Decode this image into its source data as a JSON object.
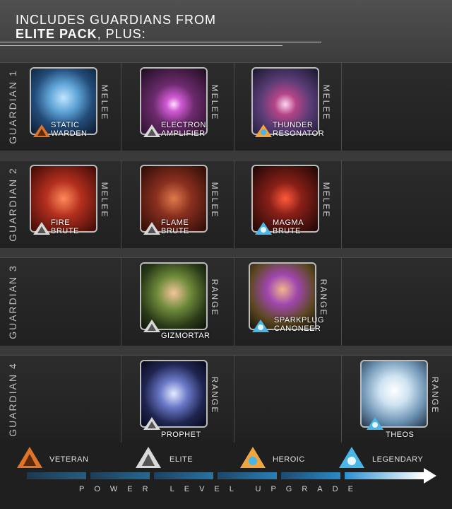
{
  "header": {
    "line1": "INCLUDES GUARDIANS FROM",
    "line2_bold": "ELITE PACK",
    "line2_rest": ", PLUS:"
  },
  "rows": [
    {
      "label": "GUARDIAN 1",
      "cards": [
        {
          "name1": "STATIC",
          "name2": "WARDEN",
          "tag": "MELEE",
          "rank": "veteran"
        },
        {
          "name1": "ELECTRON",
          "name2": "AMPLIFIER",
          "tag": "MELEE",
          "rank": "elite"
        },
        {
          "name1": "THUNDER",
          "name2": "RESONATOR",
          "tag": "MELEE",
          "rank": "heroic"
        }
      ]
    },
    {
      "label": "GUARDIAN 2",
      "cards": [
        {
          "name1": "FIRE",
          "name2": "BRUTE",
          "tag": "MELEE",
          "rank": "elite"
        },
        {
          "name1": "FLAME",
          "name2": "BRUTE",
          "tag": "MELEE",
          "rank": "elite"
        },
        {
          "name1": "MAGMA",
          "name2": "BRUTE",
          "tag": "MELEE",
          "rank": "legendary"
        }
      ]
    },
    {
      "label": "GUARDIAN 3",
      "cards": [
        {
          "name1": "GIZMORTAR",
          "name2": "",
          "tag": "RANGE",
          "rank": "elite"
        },
        {
          "name1": "SPARKPLUG",
          "name2": "CANONEER",
          "tag": "RANGE",
          "rank": "legendary"
        }
      ]
    },
    {
      "label": "GUARDIAN 4",
      "cards": [
        {
          "name1": "PROPHET",
          "name2": "",
          "tag": "RANGE",
          "rank": "elite"
        },
        {
          "name1": "THEOS",
          "name2": "",
          "tag": "RANGE",
          "rank": "legendary"
        }
      ]
    }
  ],
  "legend": {
    "veteran": "VETERAN",
    "elite": "ELITE",
    "heroic": "HEROIC",
    "legendary": "LEGENDARY"
  },
  "power_label": "POWER LEVEL UPGRADE",
  "colors": {
    "veteran": "#e0732a",
    "elite": "#d9d9d9",
    "heroic": "#f0a640",
    "legendary": "#49b6e8",
    "accent": "#2b8fd0"
  },
  "icons": [
    "veteran-rank-icon",
    "elite-rank-icon",
    "heroic-rank-icon",
    "legendary-rank-icon",
    "power-arrow-icon"
  ]
}
